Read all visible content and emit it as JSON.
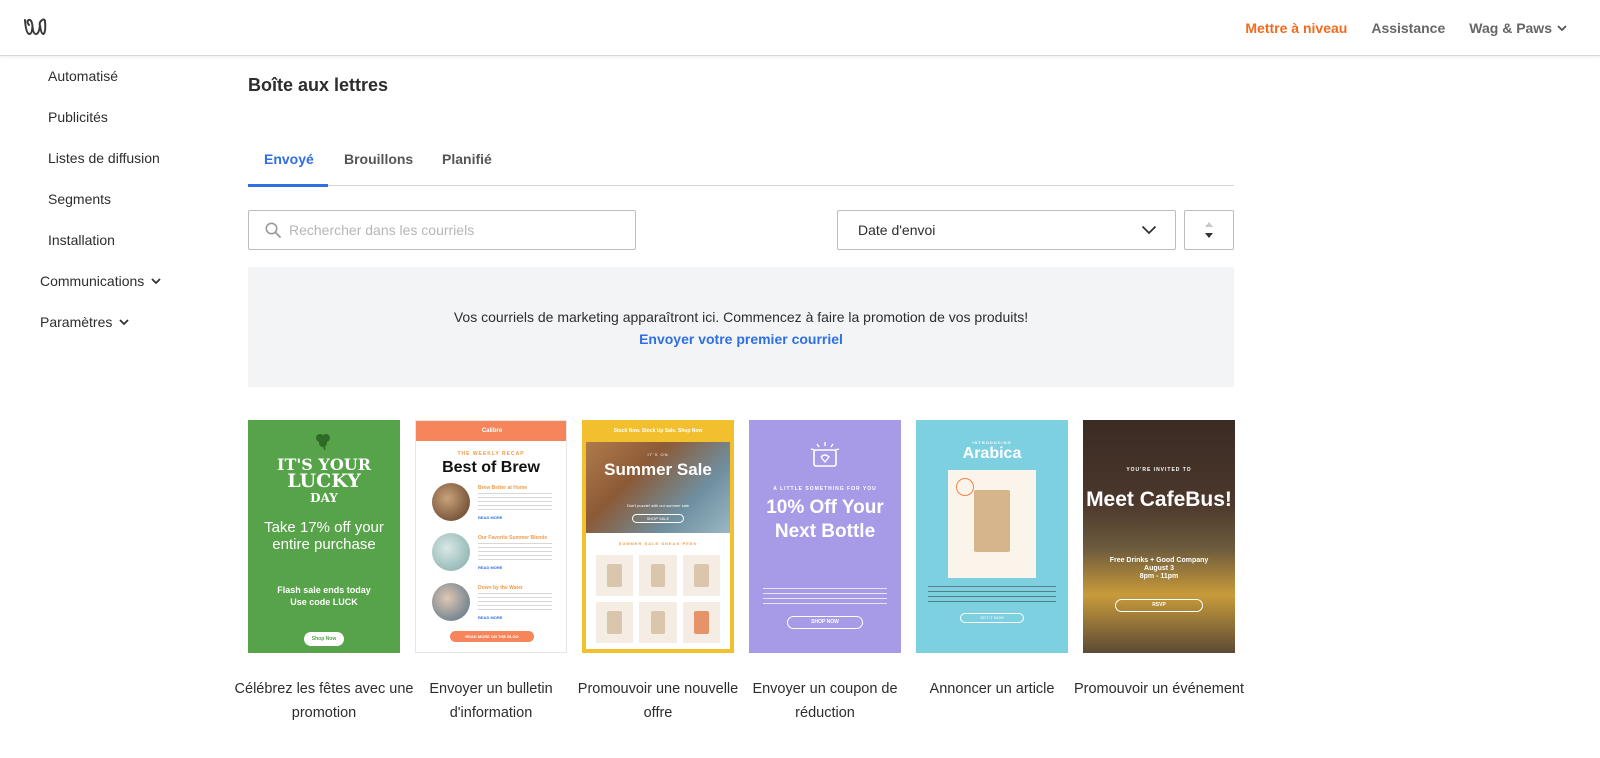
{
  "header": {
    "upgrade_label": "Mettre à niveau",
    "assistance_label": "Assistance",
    "site_label": "Wag & Paws"
  },
  "sidebar": {
    "sub_items": [
      "Automatisé",
      "Publicités",
      "Listes de diffusion",
      "Segments",
      "Installation"
    ],
    "sections": [
      "Communications",
      "Paramètres"
    ]
  },
  "main": {
    "title": "Boîte aux lettres",
    "tabs": [
      "Envoyé",
      "Brouillons",
      "Planifié"
    ],
    "search_placeholder": "Rechercher dans les courriels",
    "sort_select_value": "Date d'envoi",
    "empty_message": "Vos courriels de marketing apparaîtront ici. Commencez à faire la promotion de vos produits!",
    "empty_link": "Envoyer votre premier courriel"
  },
  "templates": [
    {
      "label": "Célébrez les fêtes avec une promotion",
      "lines": [
        "IT'S YOUR",
        "LUCKY",
        "DAY",
        "Take 17% off your entire purchase",
        "Flash sale ends today",
        "Use code LUCK",
        "Shop Now"
      ]
    },
    {
      "label": "Envoyer un bulletin d'information",
      "lines": [
        "Calibre",
        "THE WEEKLY RECAP",
        "Best of Brew",
        "Brew Better at Home",
        "Our Favorite Summer Blends",
        "Down by the Water",
        "READ MORE",
        "READ MORE ON THE BLOG"
      ]
    },
    {
      "label": "Promouvoir une nouvelle offre",
      "lines": [
        "Stock Now. Stock Up Sale. Shop Now",
        "IT'S ON",
        "Summer Sale",
        "Don't puzzle! with our summer sale",
        "SHOP SALE",
        "SUMMER SALE SNEAK PEEK"
      ]
    },
    {
      "label": "Envoyer un coupon de réduction",
      "lines": [
        "A LITTLE SOMETHING FOR YOU",
        "10% Off Your Next Bottle",
        "SHOP NOW"
      ]
    },
    {
      "label": "Annoncer un article",
      "lines": [
        "INTRODUCING",
        "Arabica",
        "GET IT NOW"
      ]
    },
    {
      "label": "Promouvoir un événement",
      "lines": [
        "YOU'RE INVITED TO",
        "Meet CafeBus!",
        "Free Drinks + Good Company",
        "August 3",
        "8pm - 11pm",
        "RSVP"
      ]
    }
  ],
  "colors": {
    "accent": "#2f6fe4",
    "upgrade": "#f26b1d"
  }
}
